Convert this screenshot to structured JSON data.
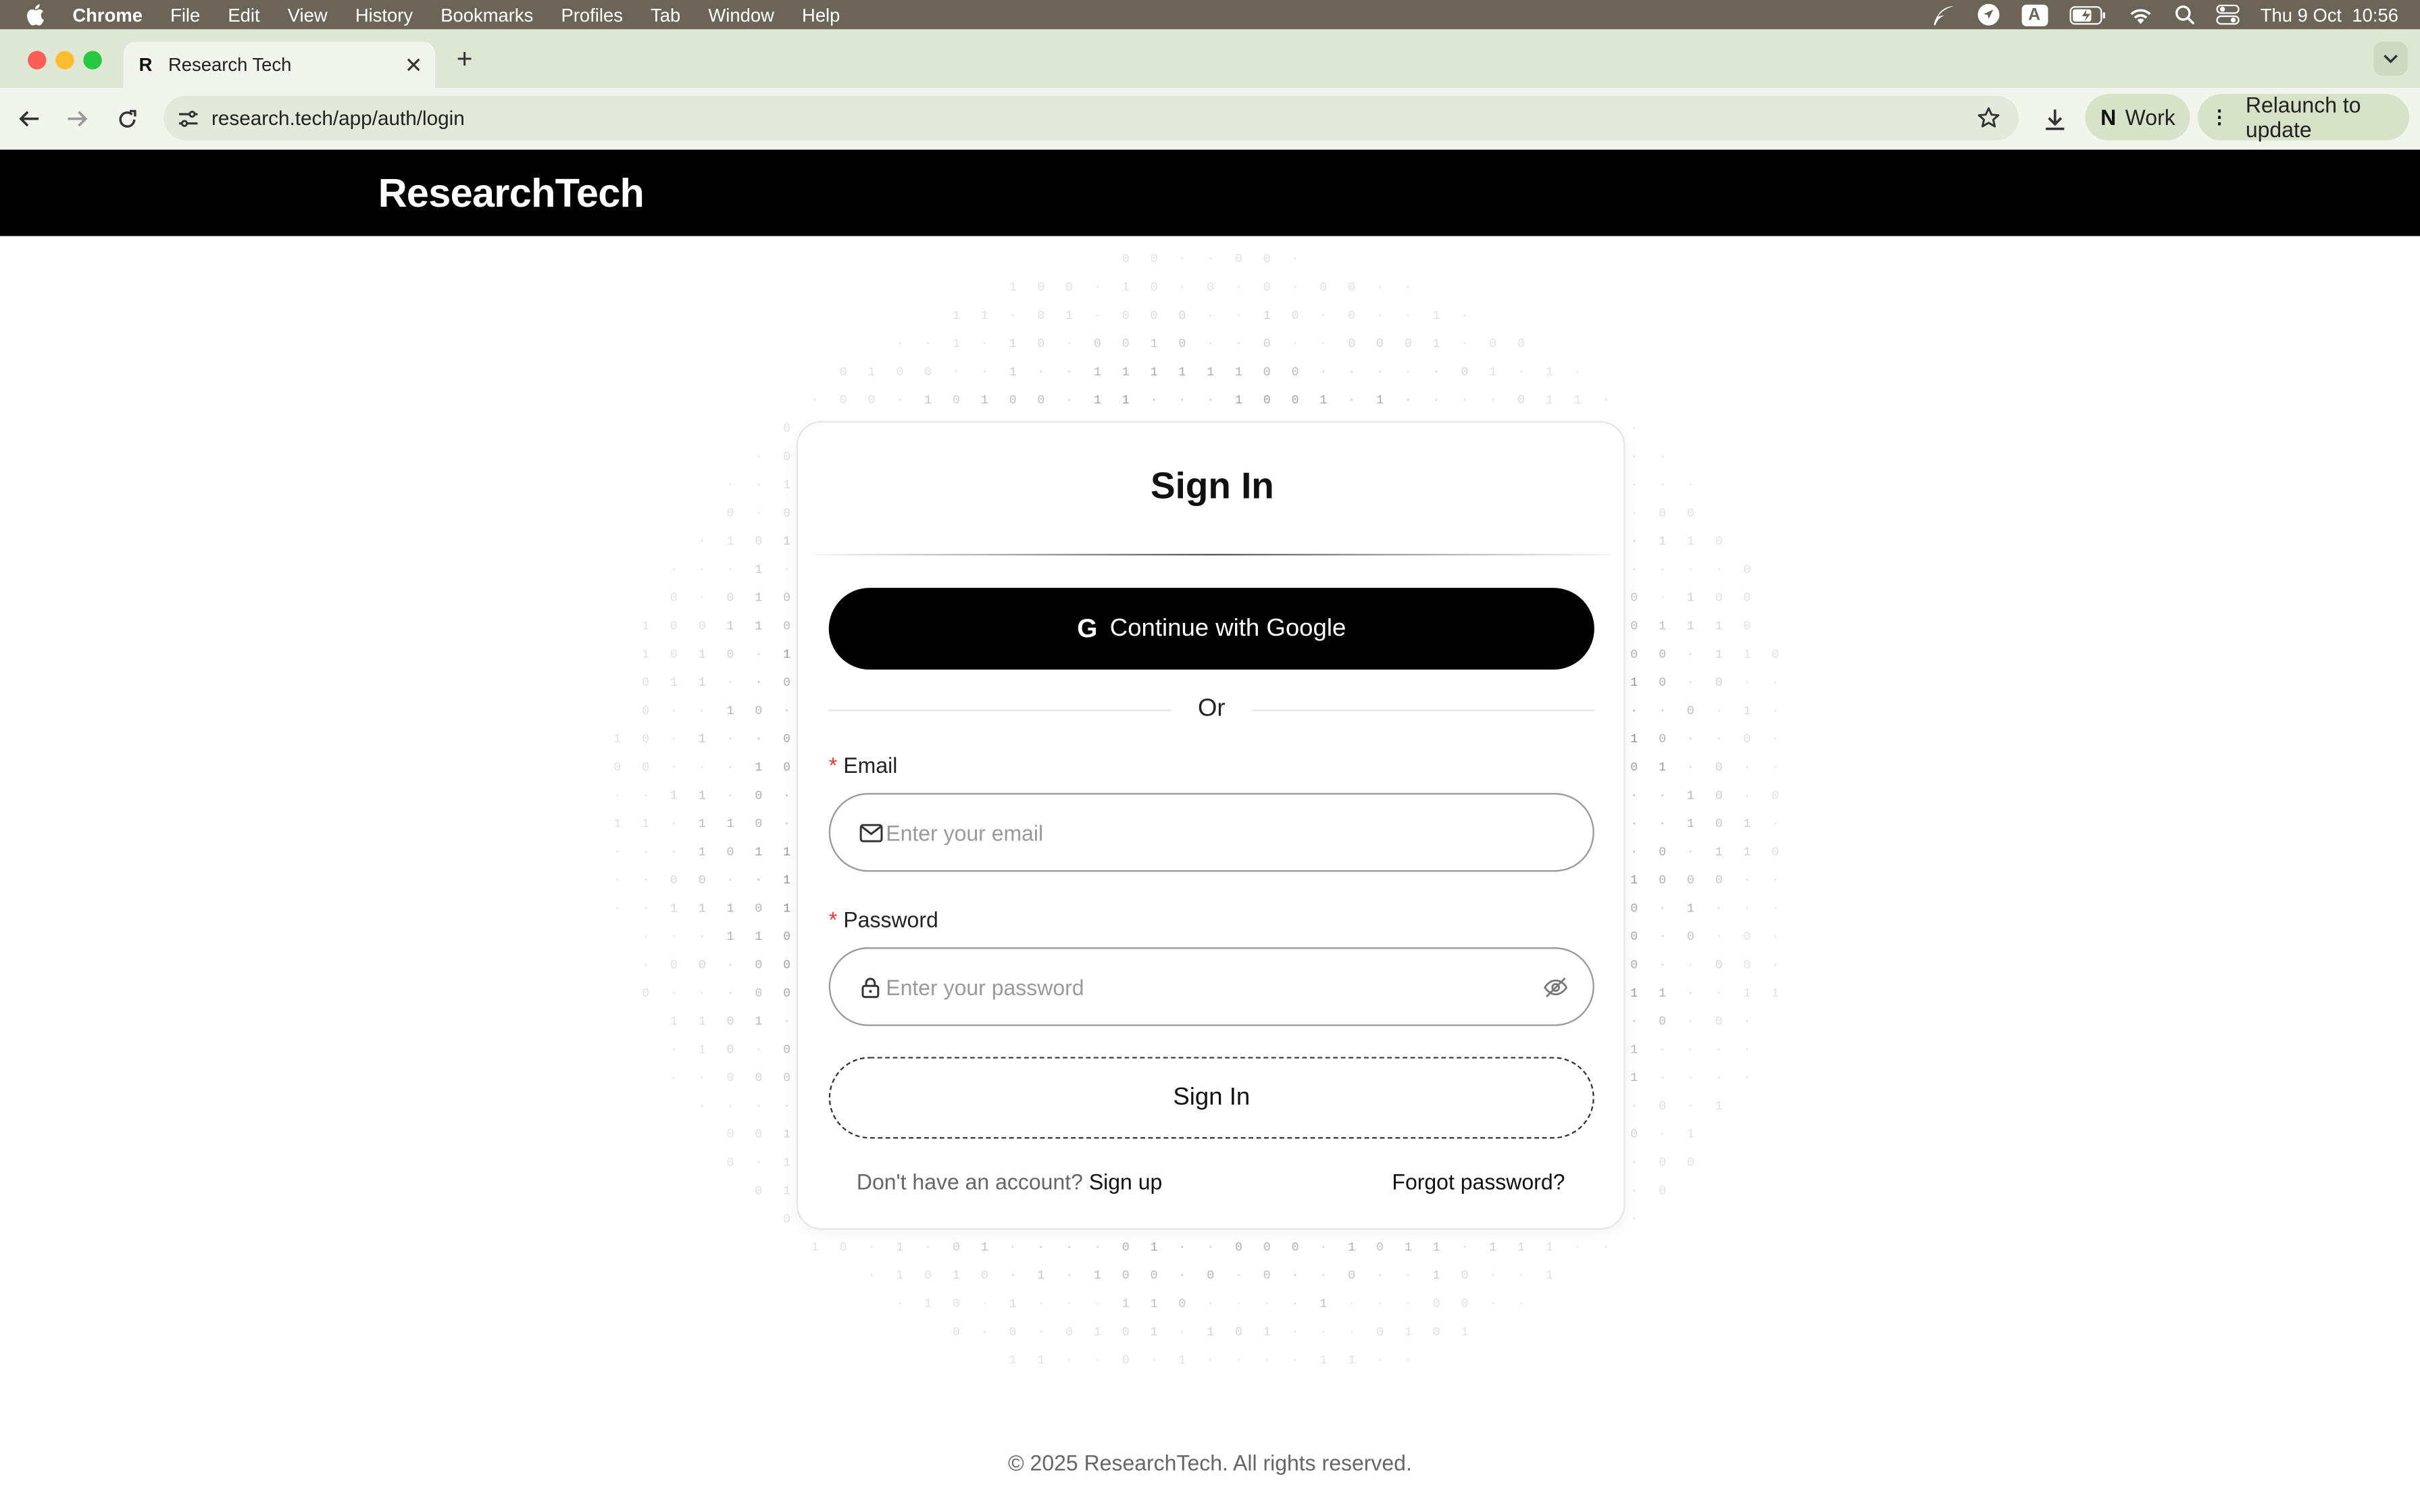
{
  "menubar": {
    "app_name": "Chrome",
    "items": [
      "File",
      "Edit",
      "View",
      "History",
      "Bookmarks",
      "Profiles",
      "Tab",
      "Window",
      "Help"
    ],
    "keyboard_indicator": "A",
    "clock": "Thu 9 Oct  10:56"
  },
  "browser": {
    "tab": {
      "favicon": "R",
      "title": "Research Tech"
    },
    "url": "research.tech/app/auth/login",
    "profile": {
      "initial": "N",
      "label": "Work"
    },
    "relaunch_label": "Relaunch to update"
  },
  "header": {
    "logo": "ResearchTech"
  },
  "signin": {
    "title": "Sign In",
    "google_label": "Continue with Google",
    "or": "Or",
    "email_label": "Email",
    "email_placeholder": "Enter your email",
    "password_label": "Password",
    "password_placeholder": "Enter your password",
    "submit_label": "Sign In",
    "no_account": "Don't have an account?",
    "signup_link": "Sign up",
    "forgot_link": "Forgot password?"
  },
  "footer": {
    "copyright": "© 2025 ResearchTech. All rights reserved."
  },
  "colors": {
    "header_bg": "#000000",
    "required": "#e53935",
    "tabstrip": "#dde7d3"
  }
}
